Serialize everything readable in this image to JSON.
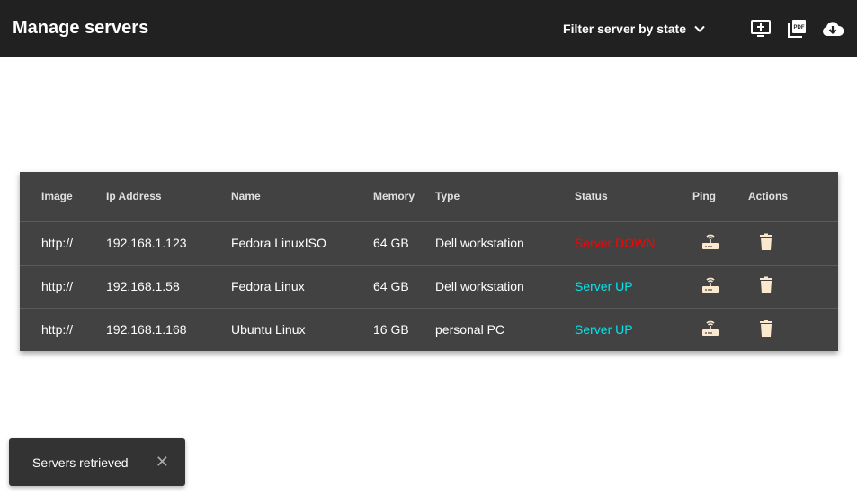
{
  "header": {
    "title": "Manage servers",
    "filter_label": "Filter server by state"
  },
  "table": {
    "columns": [
      "Image",
      "Ip Address",
      "Name",
      "Memory",
      "Type",
      "Status",
      "Ping",
      "Actions"
    ],
    "rows": [
      {
        "image": "http://",
        "ip": "192.168.1.123",
        "name": "Fedora LinuxISO",
        "memory": "64 GB",
        "type": "Dell workstation",
        "status": "Server DOWN",
        "status_color": "#ff0000"
      },
      {
        "image": "http://",
        "ip": "192.168.1.58",
        "name": "Fedora Linux",
        "memory": "64 GB",
        "type": "Dell workstation",
        "status": "Server UP",
        "status_color": "#00e5ee"
      },
      {
        "image": "http://",
        "ip": "192.168.1.168",
        "name": "Ubuntu Linux",
        "memory": "16 GB",
        "type": "personal PC",
        "status": "Server UP",
        "status_color": "#00e5ee"
      }
    ]
  },
  "snackbar": {
    "message": "Servers retrieved",
    "close": "✕"
  }
}
